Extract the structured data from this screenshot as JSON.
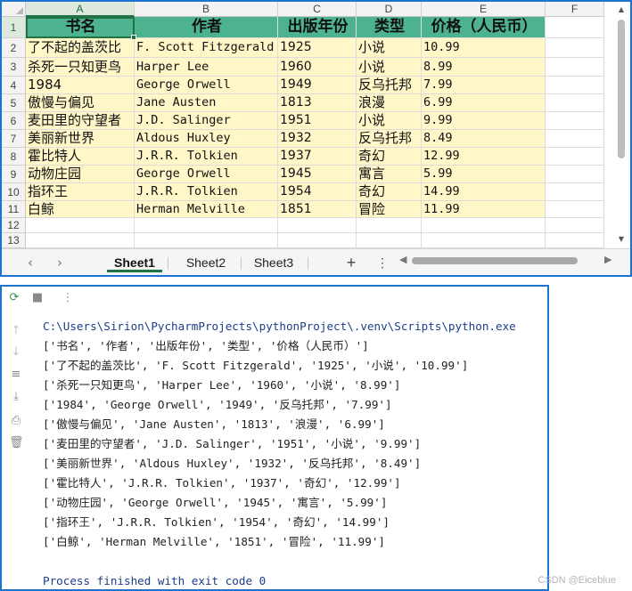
{
  "spreadsheet": {
    "columns": [
      "A",
      "B",
      "C",
      "D",
      "E",
      "F"
    ],
    "rows": [
      "1",
      "2",
      "3",
      "4",
      "5",
      "6",
      "7",
      "8",
      "9",
      "10",
      "11",
      "12",
      "13"
    ],
    "header": [
      "书名",
      "作者",
      "出版年份",
      "类型",
      "价格（人民币）"
    ],
    "data": [
      [
        "了不起的盖茨比",
        "F. Scott Fitzgerald",
        "1925",
        "小说",
        "10.99"
      ],
      [
        "杀死一只知更鸟",
        "Harper Lee",
        "1960",
        "小说",
        "8.99"
      ],
      [
        "1984",
        "George Orwell",
        "1949",
        "反乌托邦",
        "7.99"
      ],
      [
        "傲慢与偏见",
        "Jane Austen",
        "1813",
        "浪漫",
        "6.99"
      ],
      [
        "麦田里的守望者",
        "J.D. Salinger",
        "1951",
        "小说",
        "9.99"
      ],
      [
        "美丽新世界",
        "Aldous Huxley",
        "1932",
        "反乌托邦",
        "8.49"
      ],
      [
        "霍比特人",
        "J.R.R. Tolkien",
        "1937",
        "奇幻",
        "12.99"
      ],
      [
        "动物庄园",
        "George Orwell",
        "1945",
        "寓言",
        "5.99"
      ],
      [
        "指环王",
        "J.R.R. Tolkien",
        "1954",
        "奇幻",
        "14.99"
      ],
      [
        "白鲸",
        "Herman Melville",
        "1851",
        "冒险",
        "11.99"
      ]
    ],
    "sheets": [
      "Sheet1",
      "Sheet2",
      "Sheet3"
    ],
    "active_sheet": "Sheet1",
    "add_sheet_label": "+",
    "more_label": "⋮",
    "colors": {
      "header_fill": "#4db38e",
      "band_fill": "#fff7c8",
      "accent": "#217346"
    }
  },
  "console": {
    "path": "C:\\Users\\Sirion\\PycharmProjects\\pythonProject\\.venv\\Scripts\\python.exe",
    "lines": [
      "['书名', '作者', '出版年份', '类型', '价格（人民币）']",
      "['了不起的盖茨比', 'F. Scott Fitzgerald', '1925', '小说', '10.99']",
      "['杀死一只知更鸟', 'Harper Lee', '1960', '小说', '8.99']",
      "['1984', 'George Orwell', '1949', '反乌托邦', '7.99']",
      "['傲慢与偏见', 'Jane Austen', '1813', '浪漫', '6.99']",
      "['麦田里的守望者', 'J.D. Salinger', '1951', '小说', '9.99']",
      "['美丽新世界', 'Aldous Huxley', '1932', '反乌托邦', '8.49']",
      "['霍比特人', 'J.R.R. Tolkien', '1937', '奇幻', '12.99']",
      "['动物庄园', 'George Orwell', '1945', '寓言', '5.99']",
      "['指环王', 'J.R.R. Tolkien', '1954', '奇幻', '14.99']",
      "['白鲸', 'Herman Melville', '1851', '冒险', '11.99']"
    ],
    "exit_message": "Process finished with exit code 0",
    "toolbar_icons": [
      "rerun-icon",
      "stop-icon",
      "more-icon"
    ],
    "gutter_icons": [
      "arrow-up-icon",
      "arrow-down-icon",
      "soft-wrap-icon",
      "scroll-to-end-icon",
      "print-icon",
      "trash-icon"
    ]
  },
  "watermark": "CSDN @Eiceblue"
}
